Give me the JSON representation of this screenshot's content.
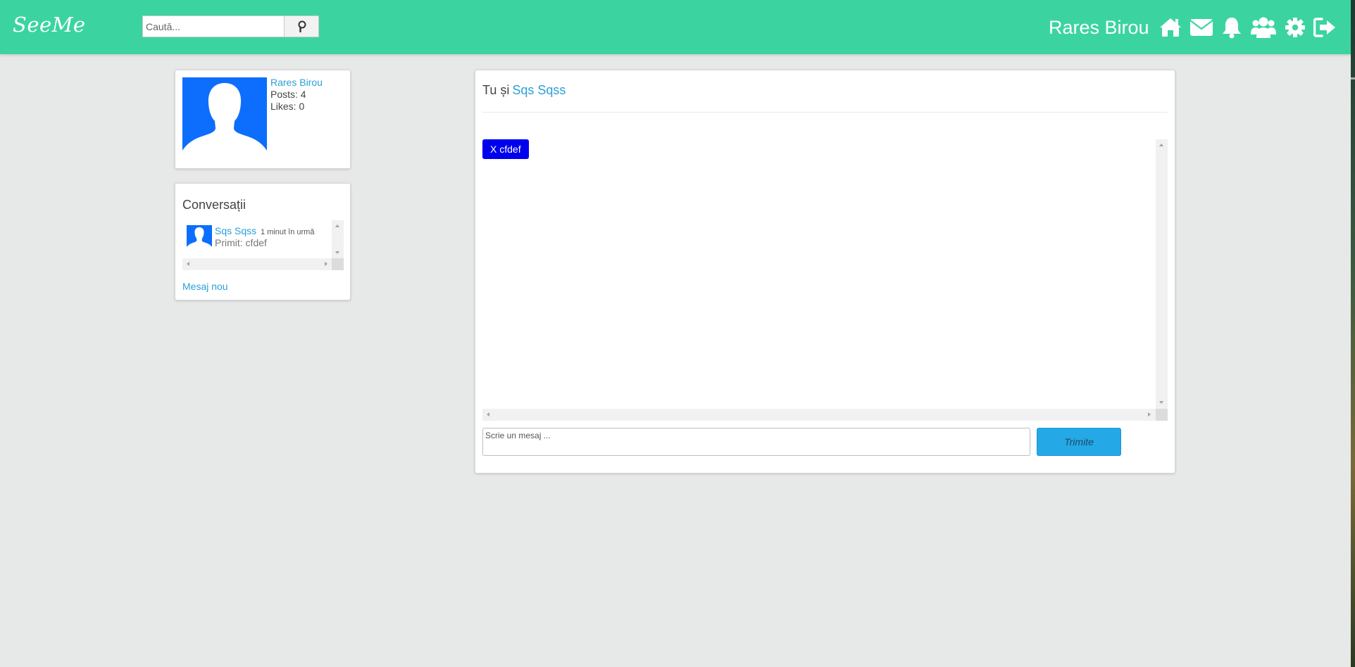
{
  "app": {
    "logo": "SeeMe",
    "search_placeholder": "Caută...",
    "username": "Rares Birou",
    "accent_color": "#3bd4a0",
    "nav_icons": [
      "home-icon",
      "envelope-icon",
      "bell-icon",
      "friends-icon",
      "gear-icon",
      "logout-icon"
    ]
  },
  "profile": {
    "name": "Rares Birou",
    "posts": "Posts: 4",
    "likes": "Likes: 0"
  },
  "conversations": {
    "title": "Conversații",
    "items": [
      {
        "name": "Sqs Sqss",
        "time": "1 minut în urmă",
        "preview": "Primit: cfdef"
      }
    ],
    "new_message": "Mesaj nou"
  },
  "chat": {
    "prefix": "Tu și",
    "partner": "Sqs Sqss",
    "messages": [
      {
        "text": "X cfdef",
        "color": "#0000ee"
      }
    ],
    "input_placeholder": "Scrie un mesaj ...",
    "send_label": "Trimite"
  }
}
